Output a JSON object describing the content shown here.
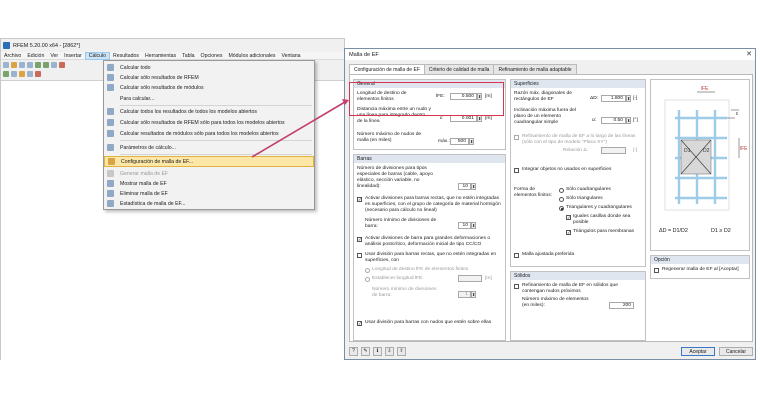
{
  "app": {
    "title": "RFEM 5.20.00 x64 - [2862*]",
    "menu": [
      "Archivo",
      "Edición",
      "Ver",
      "Insertar",
      "Cálculo",
      "Resultados",
      "Herramientas",
      "Tabla",
      "Opciones",
      "Módulos adicionales",
      "Ventana"
    ],
    "active_menu": "Cálculo"
  },
  "calc_menu": {
    "items": [
      {
        "label": "Calcular todo",
        "disabled": false
      },
      {
        "label": "Calcular sólo resultados de RFEM",
        "disabled": false
      },
      {
        "label": "Calcular sólo resultados de módulos",
        "disabled": false
      },
      {
        "label": "Para calcular...",
        "disabled": false
      },
      {
        "label": "Calcular todos los resultados de todos los modelos abiertos",
        "disabled": false
      },
      {
        "label": "Calcular sólo resultados de RFEM sólo para todos los modelos abiertos",
        "disabled": false
      },
      {
        "label": "Calcular resultados de módulos sólo para todos los modelos abiertos",
        "disabled": false
      },
      {
        "label": "Parámetros de cálculo...",
        "disabled": false
      },
      {
        "label": "Configuración de malla de EF...",
        "disabled": false,
        "highlighted": true
      },
      {
        "label": "Generar malla de EF",
        "disabled": true
      },
      {
        "label": "Mostrar malla de EF",
        "disabled": false
      },
      {
        "label": "Eliminar malla de EF",
        "disabled": false
      },
      {
        "label": "Estadística de malla de EF...",
        "disabled": false
      }
    ]
  },
  "dialog": {
    "title": "Malla de EF",
    "close_glyph": "✕",
    "tabs": [
      "Configuración de malla de EF",
      "Criterio de calidad de malla",
      "Refinamiento de malla adaptable"
    ],
    "active_tab": 0,
    "general": {
      "title": "General",
      "target_length_label": "Longitud de destino de elementos finitos",
      "target_length_symbol": "lFE:",
      "target_length_value": "0.500",
      "target_length_unit": "[m]",
      "max_distance_label": "Distancia máxima entre un nudo y una línea para integrarlo dentro de la línea",
      "max_distance_symbol": "ε:",
      "max_distance_value": "0.001",
      "max_distance_unit": "[m]",
      "max_nodes_label": "Número máximo de nudos de malla (en miles)",
      "max_nodes_symbol": "máx.:",
      "max_nodes_value": "500"
    },
    "barras": {
      "title": "Barras",
      "special_divisions_label": "Número de divisiones para tipos especiales de barras (cable, apoyo elástico, sección variable, no linealidad):",
      "special_divisions_value": "10",
      "activate_straight_label": "Activar divisiones para barras rectas, que no estén integradas en superficies, con el grupo de categoría de material hormigón (necesario para cálculo no lineal)",
      "activate_straight_checked": true,
      "min_divisions_label": "Número mínimo de divisiones de barra:",
      "min_divisions_value": "10",
      "large_deformations_label": "Activar divisiones de barra para grandes deformaciones o análisis postcrítico, deformación inicial de tipo CC/CO",
      "large_deformations_checked": true,
      "use_division_label": "Usar división para barras rectas, que no estén integradas en superficies, con",
      "use_division_checked": false,
      "target_length_lfe_label": "Longitud de destino lFE de elementos finitos",
      "set_length_label": "Establecer longitud lFE:",
      "set_length_unit": "[m]",
      "min_divisions2_label": "Número mínimo de divisiones de barra:",
      "min_divisions2_value": "1",
      "nodes_on_members_label": "Usar división para barras con nudos que estén sobre ellas",
      "nodes_on_members_checked": true
    },
    "superficies": {
      "title": "Superficies",
      "ratio_label": "Razón máx. diagonales de rectángulos de EF",
      "ratio_symbol": "ΔD:",
      "ratio_value": "1.800",
      "ratio_unit": "[-]",
      "inclination_label": "Inclinación máxima fuera del plano de un elemento cuadrangular simple",
      "inclination_symbol": "α:",
      "inclination_value": "0.50",
      "inclination_unit": "[°]",
      "refinement_label": "Refinamiento de malla de EF a lo largo de las líneas (sólo con el tipo de modelo \"Placa XY\")",
      "relation_label": "Relación Δ:",
      "relation_unit": "[-]",
      "integrate_objects_label": "Integrar objetos no usados en superficies",
      "shape_label": "Forma de elementos finitos:",
      "shape_options": [
        "Sólo cuadrangulares",
        "Sólo triangulares",
        "Triangulares y cuadrangulares"
      ],
      "shape_selected": 2,
      "equal_squares_label": "Iguales casillas donde sea posible",
      "equal_squares_checked": true,
      "triangles_membranes_label": "Triángulos para membranas",
      "triangles_membranes_checked": true,
      "preferred_mesh_label": "Malla ajustada preferida",
      "preferred_mesh_checked": false
    },
    "solidos": {
      "title": "Sólidos",
      "refinement_label": "Refinamiento de malla de EF en sólidos que contengan nudos próximos",
      "max_elements_label": "Número máximo de elementos (en miles):",
      "max_elements_value": "200"
    },
    "opcion": {
      "title": "Opción",
      "regenerate_label": "Regenerar malla de EF al [Aceptar]"
    },
    "preview": {
      "lfe_label": "lFE",
      "d1_label": "D1",
      "d2_label": "D2",
      "eps_label": "ε",
      "ratio_formula": "ΔD = D1/D2",
      "ineq": "D1 ≥ D2"
    },
    "buttons": {
      "ok": "Aceptar",
      "cancel": "Cancelar"
    }
  },
  "colors": {
    "highlight_frame": "#d9344f",
    "arrow": "#c2406a",
    "accent_blue": "#2a6fb8"
  }
}
